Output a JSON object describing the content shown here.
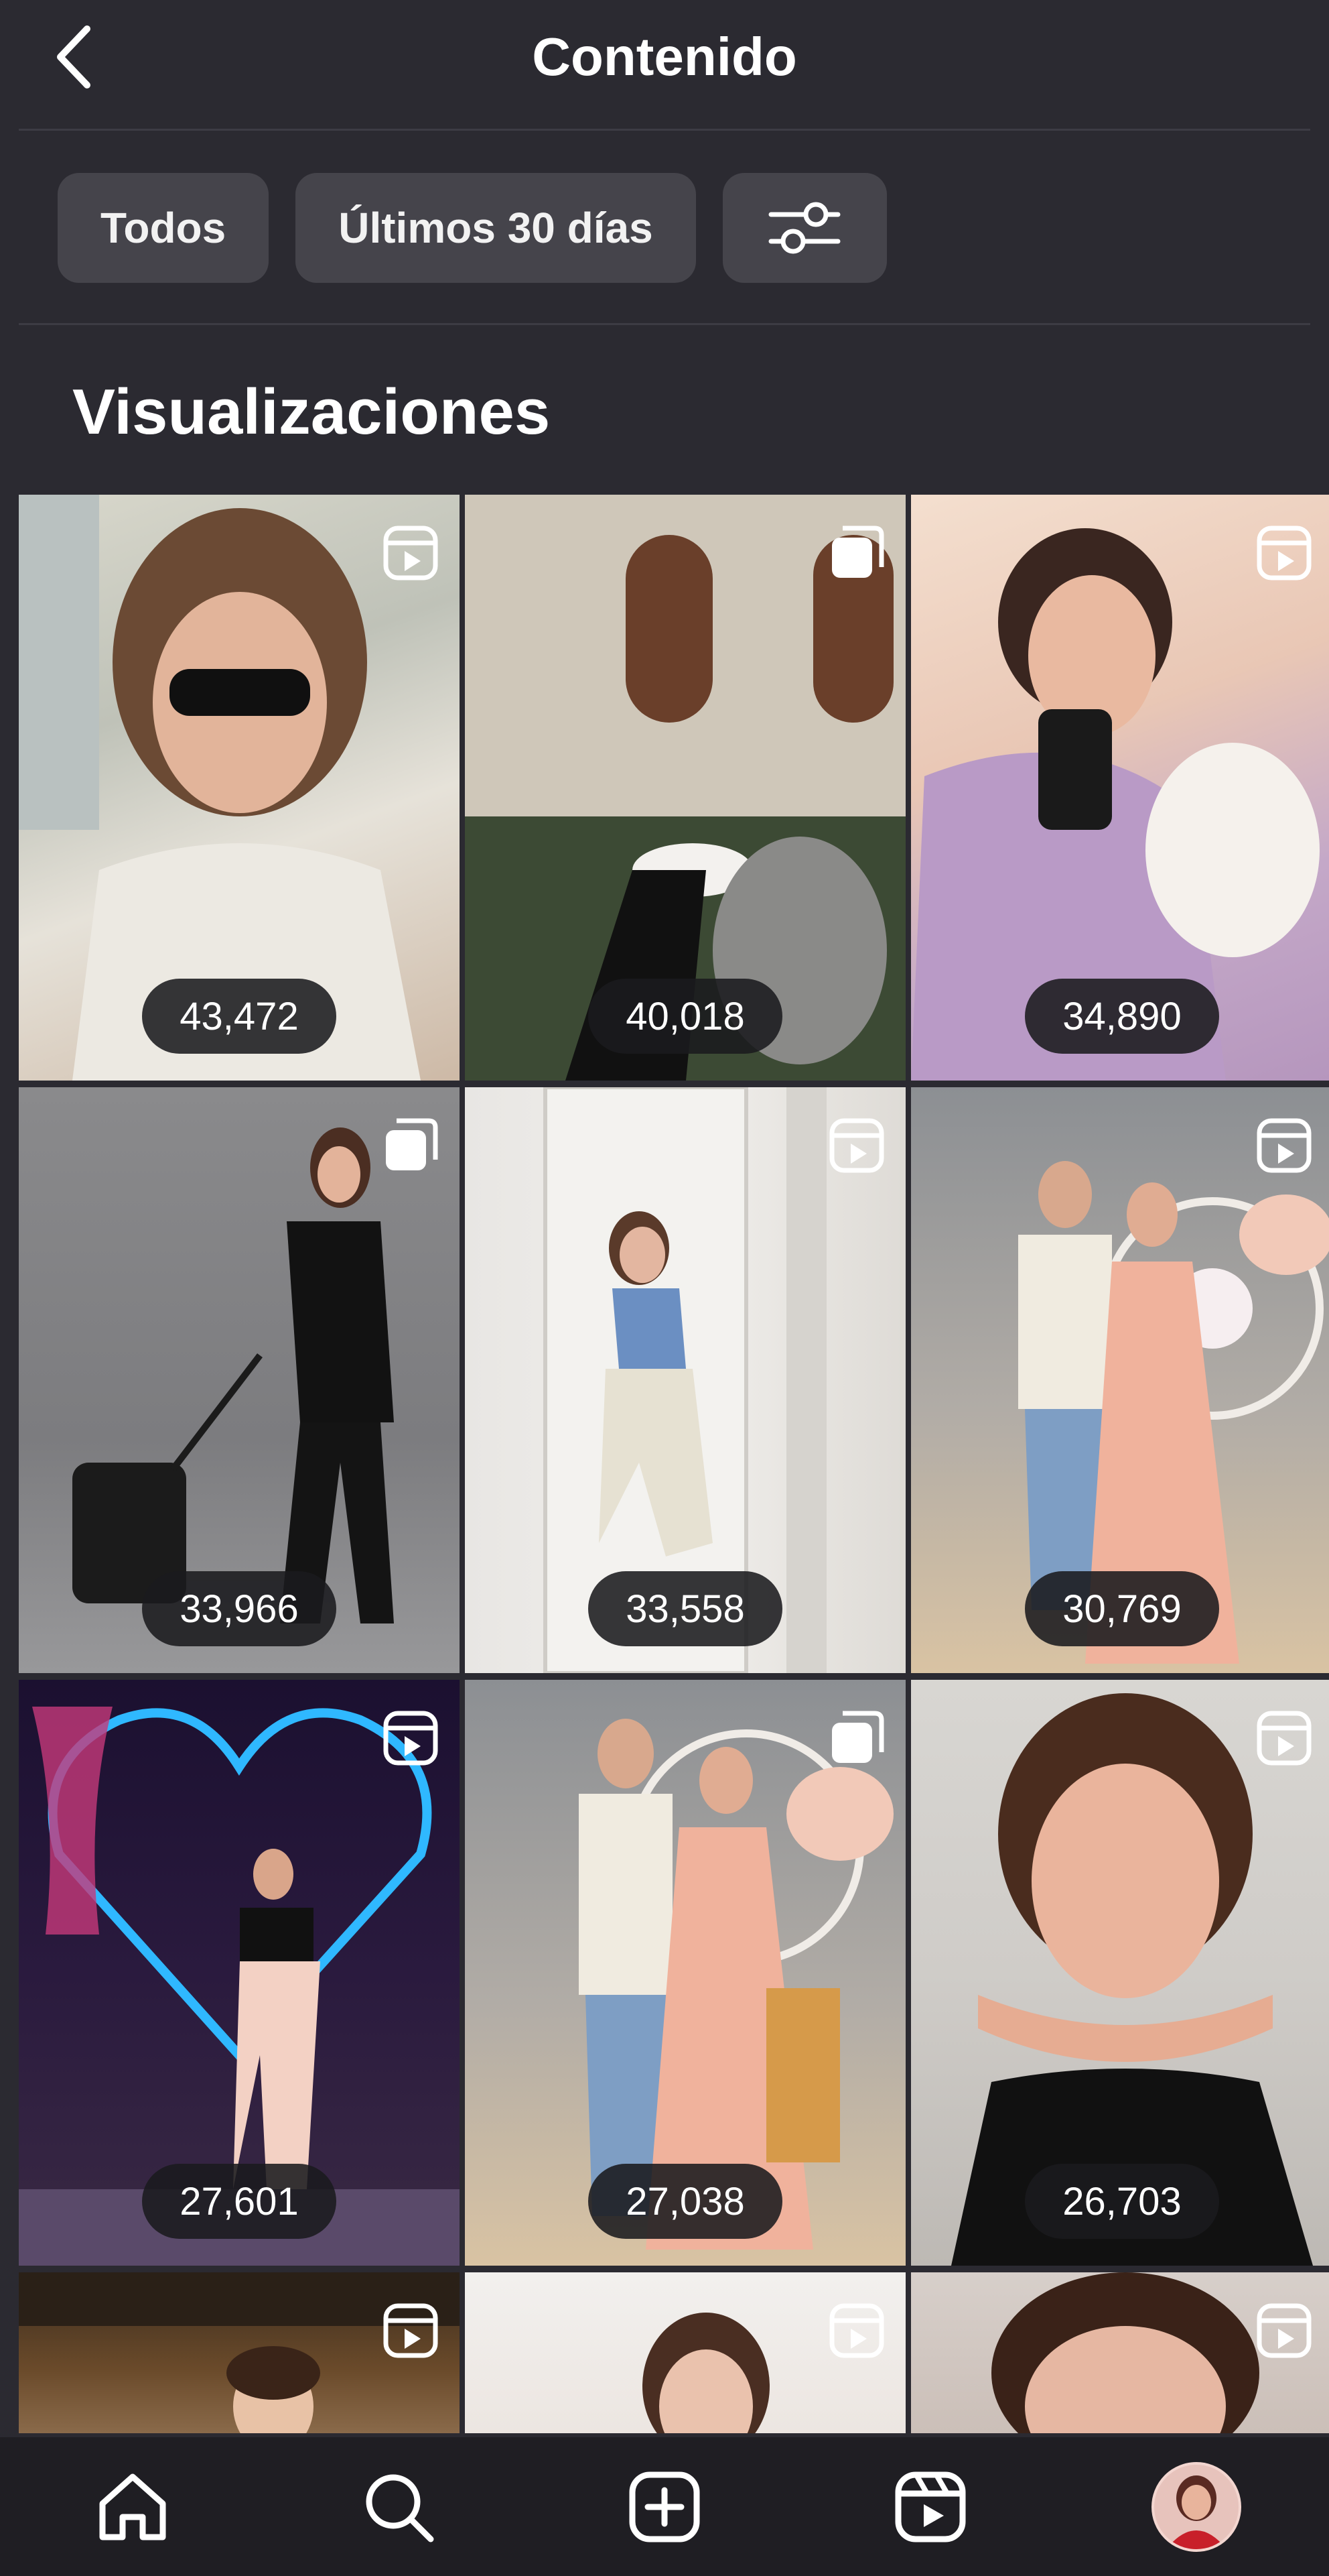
{
  "header": {
    "title": "Contenido"
  },
  "filters": {
    "all_label": "Todos",
    "range_label": "Últimos 30 días"
  },
  "section": {
    "title": "Visualizaciones"
  },
  "grid": {
    "items": [
      {
        "views": "43,472",
        "type_icon": "reel-icon"
      },
      {
        "views": "40,018",
        "type_icon": "carousel-icon"
      },
      {
        "views": "34,890",
        "type_icon": "reel-icon"
      },
      {
        "views": "33,966",
        "type_icon": "carousel-icon"
      },
      {
        "views": "33,558",
        "type_icon": "reel-icon"
      },
      {
        "views": "30,769",
        "type_icon": "reel-icon"
      },
      {
        "views": "27,601",
        "type_icon": "reel-icon"
      },
      {
        "views": "27,038",
        "type_icon": "carousel-icon"
      },
      {
        "views": "26,703",
        "type_icon": "reel-icon"
      },
      {
        "type_icon": "reel-icon"
      },
      {
        "type_icon": "reel-icon"
      },
      {
        "type_icon": "reel-icon"
      }
    ]
  },
  "nav": {
    "icons": [
      "home-icon",
      "search-icon",
      "create-icon",
      "reels-icon",
      "profile-avatar"
    ]
  }
}
